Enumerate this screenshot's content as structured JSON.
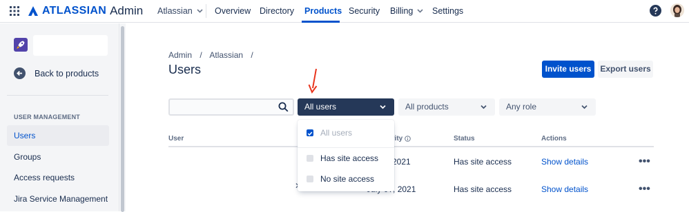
{
  "header": {
    "brand": "ATLASSIAN",
    "product": "Admin",
    "org": "Atlassian",
    "nav": [
      "Overview",
      "Directory",
      "Products",
      "Security",
      "Billing",
      "Settings"
    ],
    "active_nav": "Products",
    "icons": [
      "app-switcher-icon",
      "atlassian-logo-icon",
      "chevron-down-icon",
      "help-icon",
      "avatar"
    ]
  },
  "sidebar": {
    "back": "Back to products",
    "section": "USER MANAGEMENT",
    "items": [
      "Users",
      "Groups",
      "Access requests",
      "Jira Service Management"
    ],
    "selected": "Users"
  },
  "main": {
    "breadcrumb": [
      "Admin",
      "/",
      "Atlassian",
      "/"
    ],
    "title": "Users",
    "invite": "Invite users",
    "export": "Export users",
    "filters": {
      "users": "All users",
      "products": "All products",
      "role": "Any role"
    },
    "columns": [
      "User",
      "Last activity",
      "Status",
      "Actions"
    ],
    "column_header_partial": "vity",
    "rows": [
      {
        "last_activity": "2021",
        "status": "Has site access",
        "action": "Show details",
        "more": "•••"
      },
      {
        "last_activity": "July 0?, 2021",
        "status": "Has site access",
        "action": "Show details",
        "more": "•••"
      }
    ]
  },
  "dropdown": {
    "options": [
      {
        "label": "All users",
        "checked": true
      },
      {
        "label": "Has site access",
        "checked": false
      },
      {
        "label": "No site access",
        "checked": false
      }
    ]
  },
  "colors": {
    "brand_blue": "#0052CC",
    "dark_filter": "#253858",
    "annotation_arrow": "#E8331C"
  }
}
